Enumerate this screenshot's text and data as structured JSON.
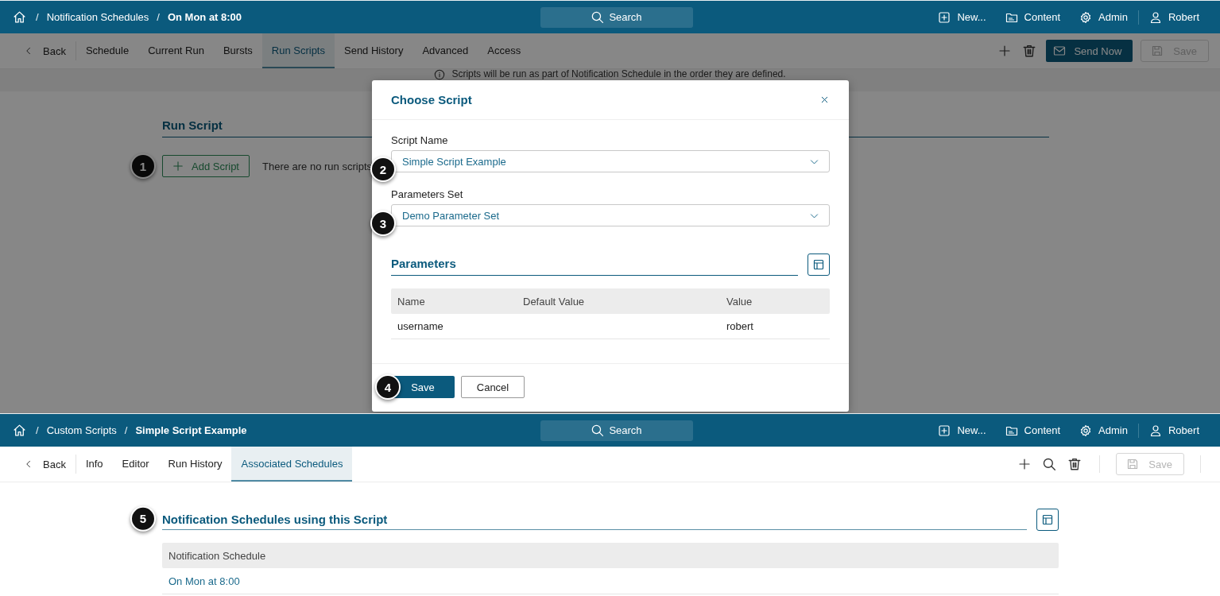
{
  "top_screen": {
    "header": {
      "crumbs": [
        {
          "kind": "separator",
          "text": "/"
        },
        {
          "kind": "link",
          "text": "Notification Schedules"
        },
        {
          "kind": "separator",
          "text": "/"
        },
        {
          "kind": "current",
          "text": "On Mon at 8:00"
        }
      ],
      "search": {
        "placeholder": "Search"
      },
      "nav": [
        {
          "kind": "new",
          "label": "New..."
        },
        {
          "kind": "content",
          "label": "Content"
        },
        {
          "kind": "admin",
          "label": "Admin"
        },
        {
          "kind": "user",
          "label": "Robert"
        }
      ]
    },
    "dimmed": true,
    "tabbar": {
      "back": "Back",
      "tabs": [
        {
          "label": "Schedule",
          "selected": false
        },
        {
          "label": "Current Run",
          "selected": false
        },
        {
          "label": "Bursts",
          "selected": false
        },
        {
          "label": "Run Scripts",
          "selected": true
        },
        {
          "label": "Send History",
          "selected": false
        },
        {
          "label": "Advanced",
          "selected": false
        },
        {
          "label": "Access",
          "selected": false
        }
      ],
      "actions": [
        {
          "kind": "add"
        },
        {
          "kind": "delete"
        },
        {
          "kind": "send",
          "label": "Send Now"
        },
        {
          "kind": "save",
          "label": "Save",
          "disabled": true
        }
      ]
    },
    "info": "Scripts will be run as part of Notification Schedule in the order they are defined.",
    "section_title": "Run Script",
    "add_button": {
      "label": "Add Script",
      "callout": "1"
    },
    "empty_text": "There are no run scripts"
  },
  "dialog": {
    "title": "Choose Script",
    "fields": [
      {
        "label": "Script Name",
        "value": "Simple Script Example",
        "callout": "2"
      },
      {
        "label": "Parameters Set",
        "value": "Demo Parameter Set",
        "callout": "3"
      }
    ],
    "section_title": "Parameters",
    "columns": [
      "Name",
      "Default Value",
      "Value"
    ],
    "rows": [
      [
        "username",
        "",
        "robert"
      ]
    ],
    "buttons": [
      {
        "kind": "primary",
        "label": "Save",
        "callout": "4"
      },
      {
        "kind": "secondary",
        "label": "Cancel"
      }
    ]
  },
  "bottom_screen": {
    "header": {
      "crumbs": [
        {
          "kind": "separator",
          "text": "/"
        },
        {
          "kind": "link",
          "text": "Custom Scripts"
        },
        {
          "kind": "separator",
          "text": "/"
        },
        {
          "kind": "current",
          "text": "Simple Script Example"
        }
      ],
      "search": {
        "placeholder": "Search"
      },
      "nav": [
        {
          "kind": "new",
          "label": "New..."
        },
        {
          "kind": "content",
          "label": "Content"
        },
        {
          "kind": "admin",
          "label": "Admin"
        },
        {
          "kind": "user",
          "label": "Robert"
        }
      ]
    },
    "tabbar": {
      "back": "Back",
      "tabs": [
        {
          "label": "Info",
          "selected": false
        },
        {
          "label": "Editor",
          "selected": false
        },
        {
          "label": "Run History",
          "selected": false
        },
        {
          "label": "Associated Schedules",
          "selected": true
        }
      ],
      "actions": [
        {
          "kind": "add"
        },
        {
          "kind": "search"
        },
        {
          "kind": "delete"
        },
        {
          "kind": "save",
          "label": "Save",
          "disabled": true
        }
      ]
    },
    "section_title": {
      "text": "Notification Schedules using this Script",
      "callout": "5"
    },
    "columns": [
      "Notification Schedule"
    ],
    "rows": [
      [
        "On Mon at 8:00"
      ]
    ]
  }
}
